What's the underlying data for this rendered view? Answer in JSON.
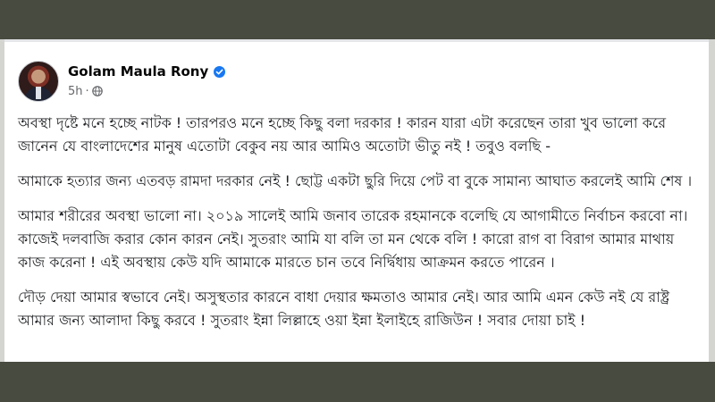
{
  "post": {
    "author": "Golam Maula Rony",
    "time": "5h",
    "dot": "·",
    "paragraphs": [
      "অবস্থা দৃষ্টে মনে হচ্ছে নাটক ! তারপরও মনে হচ্ছে কিছু বলা দরকার ! কারন যারা এটা করেছেন তারা খুব ভালো করে জানেন যে বাংলাদেশের মানুষ এতোটা বেকুব নয় আর আমিও অতোটা ভীতু নই ! তবুও বলছি -",
      "আমাকে হত্যার জন্য এতবড় রামদা দরকার নেই ! ছোট্ট একটা ছুরি দিয়ে পেট বা বুকে সামান্য আঘাত করলেই আমি শেষ ।",
      "আমার শরীরের অবস্থা ভালো না। ২০১৯ সালেই আমি জনাব তারেক রহমানকে বলেছি যে আগামীতে নির্বাচন করবো না। কাজেই দলবাজি করার কোন কারন নেই। সুতরাং আমি যা বলি তা মন থেকে বলি ! কারো রাগ বা বিরাগ আমার মাথায় কাজ করেনা ! এই অবস্থায় কেউ যদি আমাকে মারতে চান তবে নির্দ্বিধায় আক্রমন করতে পারেন ।",
      "দৌড় দেয়া আমার স্বভাবে নেই। অসুস্থতার কারনে বাধা দেয়ার ক্ষমতাও আমার নেই। আর আমি এমন কেউ নই যে রাষ্ট্র আমার জন্য আলাদা কিছু করবে ! সুতরাং ইন্না লিল্লাহে ওয়া ইন্না ইলাইহে রাজিউন ! সবার দোয়া চাই !"
    ]
  },
  "icons": {
    "verified": "verified-badge-icon",
    "privacy": "globe-icon"
  },
  "colors": {
    "frame": "#474b40",
    "verified": "#1877f2",
    "meta": "#65676b",
    "text": "#1c1e21"
  }
}
